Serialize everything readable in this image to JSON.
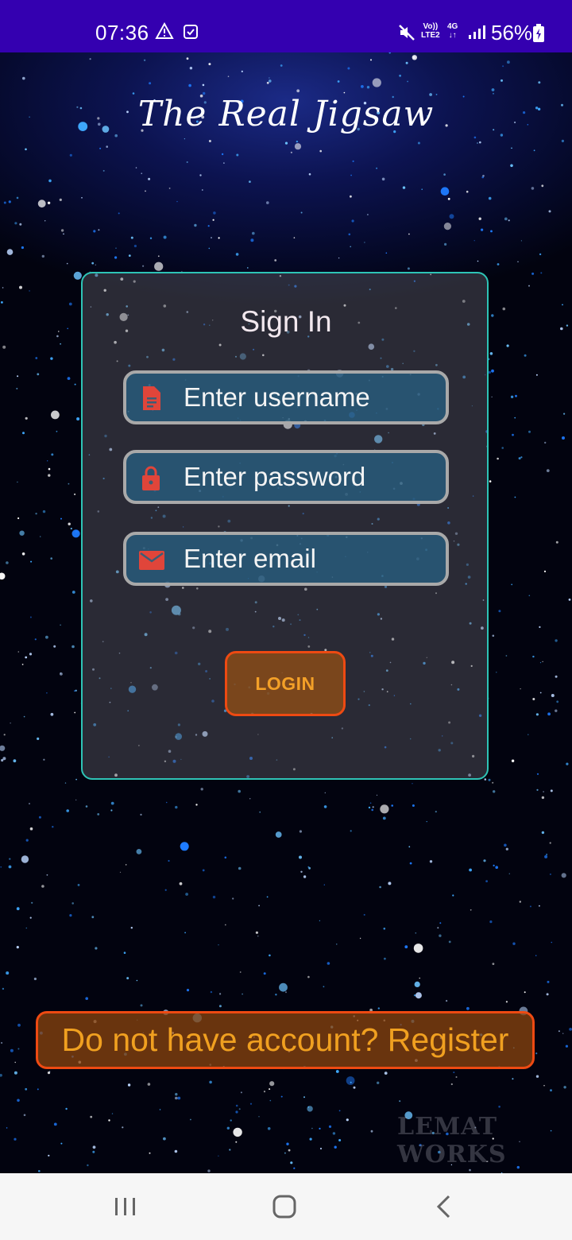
{
  "status_bar": {
    "time": "07:36",
    "volte_line1": "Vo))",
    "volte_line2": "LTE2",
    "network_line1": "4G",
    "network_line2": "↓↑",
    "battery": "56%"
  },
  "app": {
    "title": "The Real Jigsaw",
    "watermark": "LEMAT WORKS"
  },
  "signin": {
    "heading": "Sign In",
    "username_placeholder": "Enter username",
    "password_placeholder": "Enter password",
    "email_placeholder": "Enter email",
    "login_label": "LOGIN"
  },
  "register": {
    "label": "Do not have account? Register"
  },
  "colors": {
    "status_bar": "#3400b0",
    "card_border": "#2ec4b6",
    "button_border": "#ee4a12",
    "button_text": "#f3a028",
    "icon_red": "#e0453a"
  },
  "icons": {
    "username": "document-icon",
    "password": "lock-icon",
    "email": "mail-icon"
  }
}
